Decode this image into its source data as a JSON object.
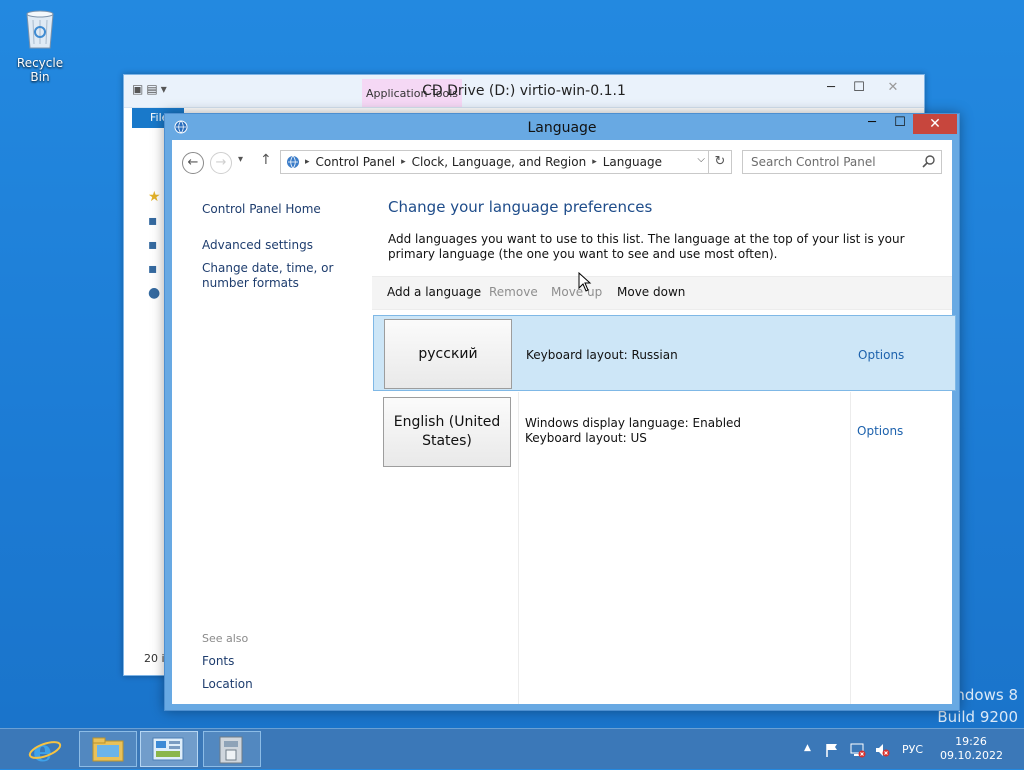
{
  "desktop": {
    "recycle_bin_label": "Recycle Bin",
    "watermark_line1": "ndows 8",
    "watermark_line2": "Build 9200"
  },
  "background_window": {
    "title": "CD Drive (D:) virtio-win-0.1.1",
    "context_tab": "Application Tools",
    "file_tab": "File",
    "status": "20 i"
  },
  "window": {
    "title": "Language",
    "minimize_glyph": "─",
    "maximize_glyph": "☐",
    "close_glyph": "✕"
  },
  "nav": {
    "back_glyph": "←",
    "forward_glyph": "→",
    "recent_glyph": "▾",
    "up_glyph": "↑",
    "breadcrumbs": [
      "Control Panel",
      "Clock, Language, and Region",
      "Language"
    ],
    "separator": "▸",
    "dropdown_glyph": "⌵",
    "refresh_glyph": "↻",
    "search_placeholder": "Search Control Panel"
  },
  "left_pane": {
    "home": "Control Panel Home",
    "advanced": "Advanced settings",
    "change_date": "Change date, time, or number formats",
    "see_also": "See also",
    "fonts": "Fonts",
    "location": "Location"
  },
  "main": {
    "heading": "Change your language preferences",
    "description": "Add languages you want to use to this list. The language at the top of your list is your primary language (the one you want to see and use most often).",
    "toolbar": {
      "add": "Add a language",
      "remove": "Remove",
      "move_up": "Move up",
      "move_down": "Move down"
    },
    "languages": [
      {
        "name": "русский",
        "line1": "Keyboard layout: Russian",
        "line2": "",
        "options": "Options",
        "selected": true
      },
      {
        "name": "English (United States)",
        "line1": "Windows display language: Enabled",
        "line2": "Keyboard layout: US",
        "options": "Options",
        "selected": false
      }
    ]
  },
  "taskbar": {
    "apps": [
      "internet-explorer",
      "file-explorer",
      "control-panel",
      "installer"
    ],
    "tray_arrow": "▲",
    "language": "РУС",
    "time": "19:26",
    "date": "09.10.2022"
  },
  "colors": {
    "desktop": "#1c7bd4",
    "window_frame": "#68a9e3",
    "close_button": "#c7463d",
    "link": "#1d62ad",
    "selection": "#cde6f7"
  }
}
